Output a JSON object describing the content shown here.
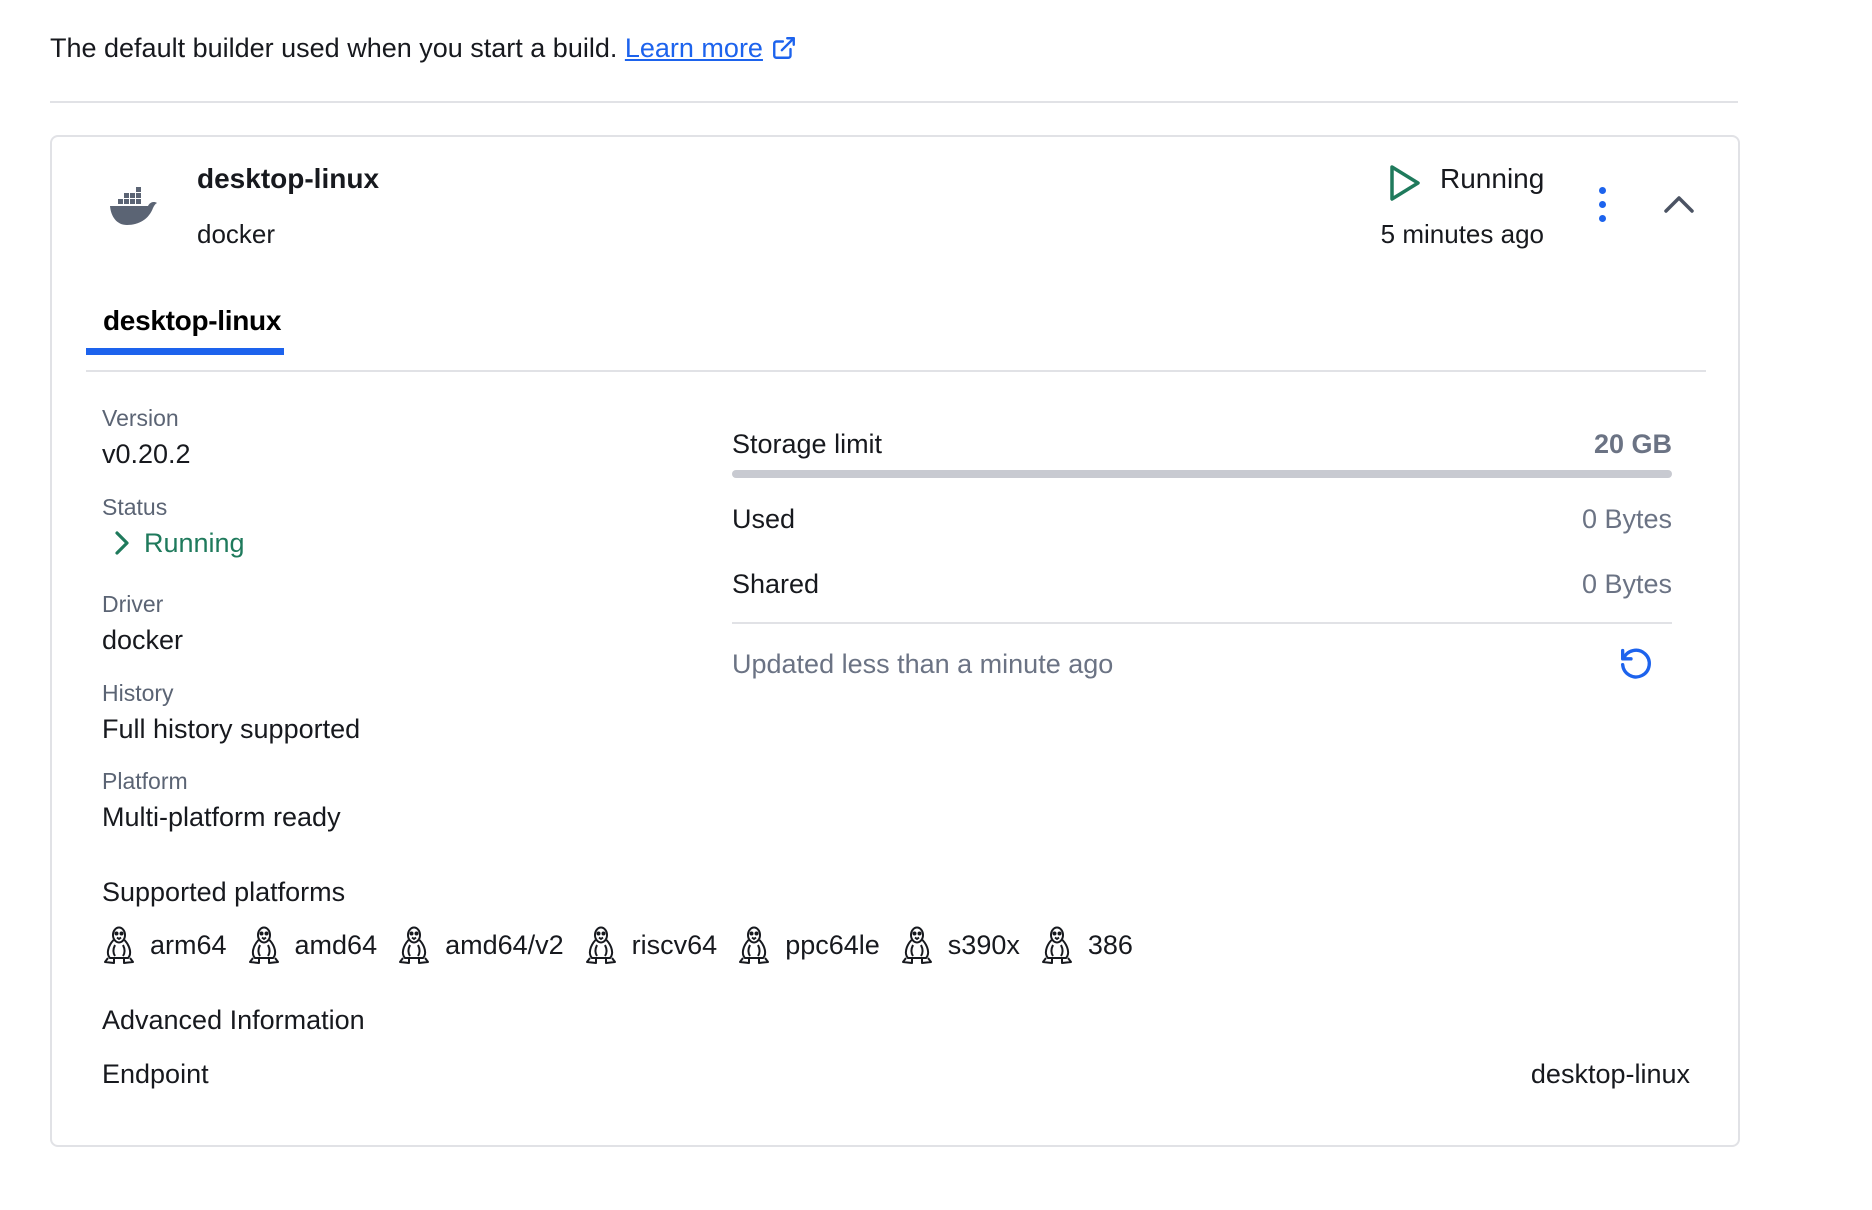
{
  "intro": {
    "text": "The default builder used when you start a build.",
    "link": "Learn more"
  },
  "builder": {
    "name": "desktop-linux",
    "driver": "docker",
    "state": "Running",
    "state_time": "5 minutes ago"
  },
  "tabs": [
    {
      "label": "desktop-linux",
      "active": true
    }
  ],
  "details": {
    "version_label": "Version",
    "version": "v0.20.2",
    "status_label": "Status",
    "status": "Running",
    "driver_label": "Driver",
    "driver": "docker",
    "history_label": "History",
    "history": "Full history supported",
    "platform_label": "Platform",
    "platform": "Multi-platform ready"
  },
  "storage": {
    "limit_label": "Storage limit",
    "limit": "20 GB",
    "usage_fraction": 0,
    "used_label": "Used",
    "used": "0 Bytes",
    "shared_label": "Shared",
    "shared": "0 Bytes",
    "updated": "Updated less than a minute ago"
  },
  "supported_platforms": {
    "title": "Supported platforms",
    "items": [
      "arm64",
      "amd64",
      "amd64/v2",
      "riscv64",
      "ppc64le",
      "s390x",
      "386"
    ]
  },
  "advanced": {
    "title": "Advanced Information",
    "endpoint_label": "Endpoint",
    "endpoint": "desktop-linux"
  },
  "colors": {
    "accent": "#1d63ed",
    "running_green": "#1f7a5c",
    "muted_text": "#5b6474",
    "border": "#e1e2e6"
  },
  "icons": {
    "builder": "docker-whale-icon",
    "state": "play-icon",
    "menu": "kebab-menu-icon",
    "collapse": "chevron-up-icon",
    "status": "chevron-right-icon",
    "refresh": "refresh-icon",
    "platform": "linux-tux-icon",
    "external": "external-link-icon"
  }
}
